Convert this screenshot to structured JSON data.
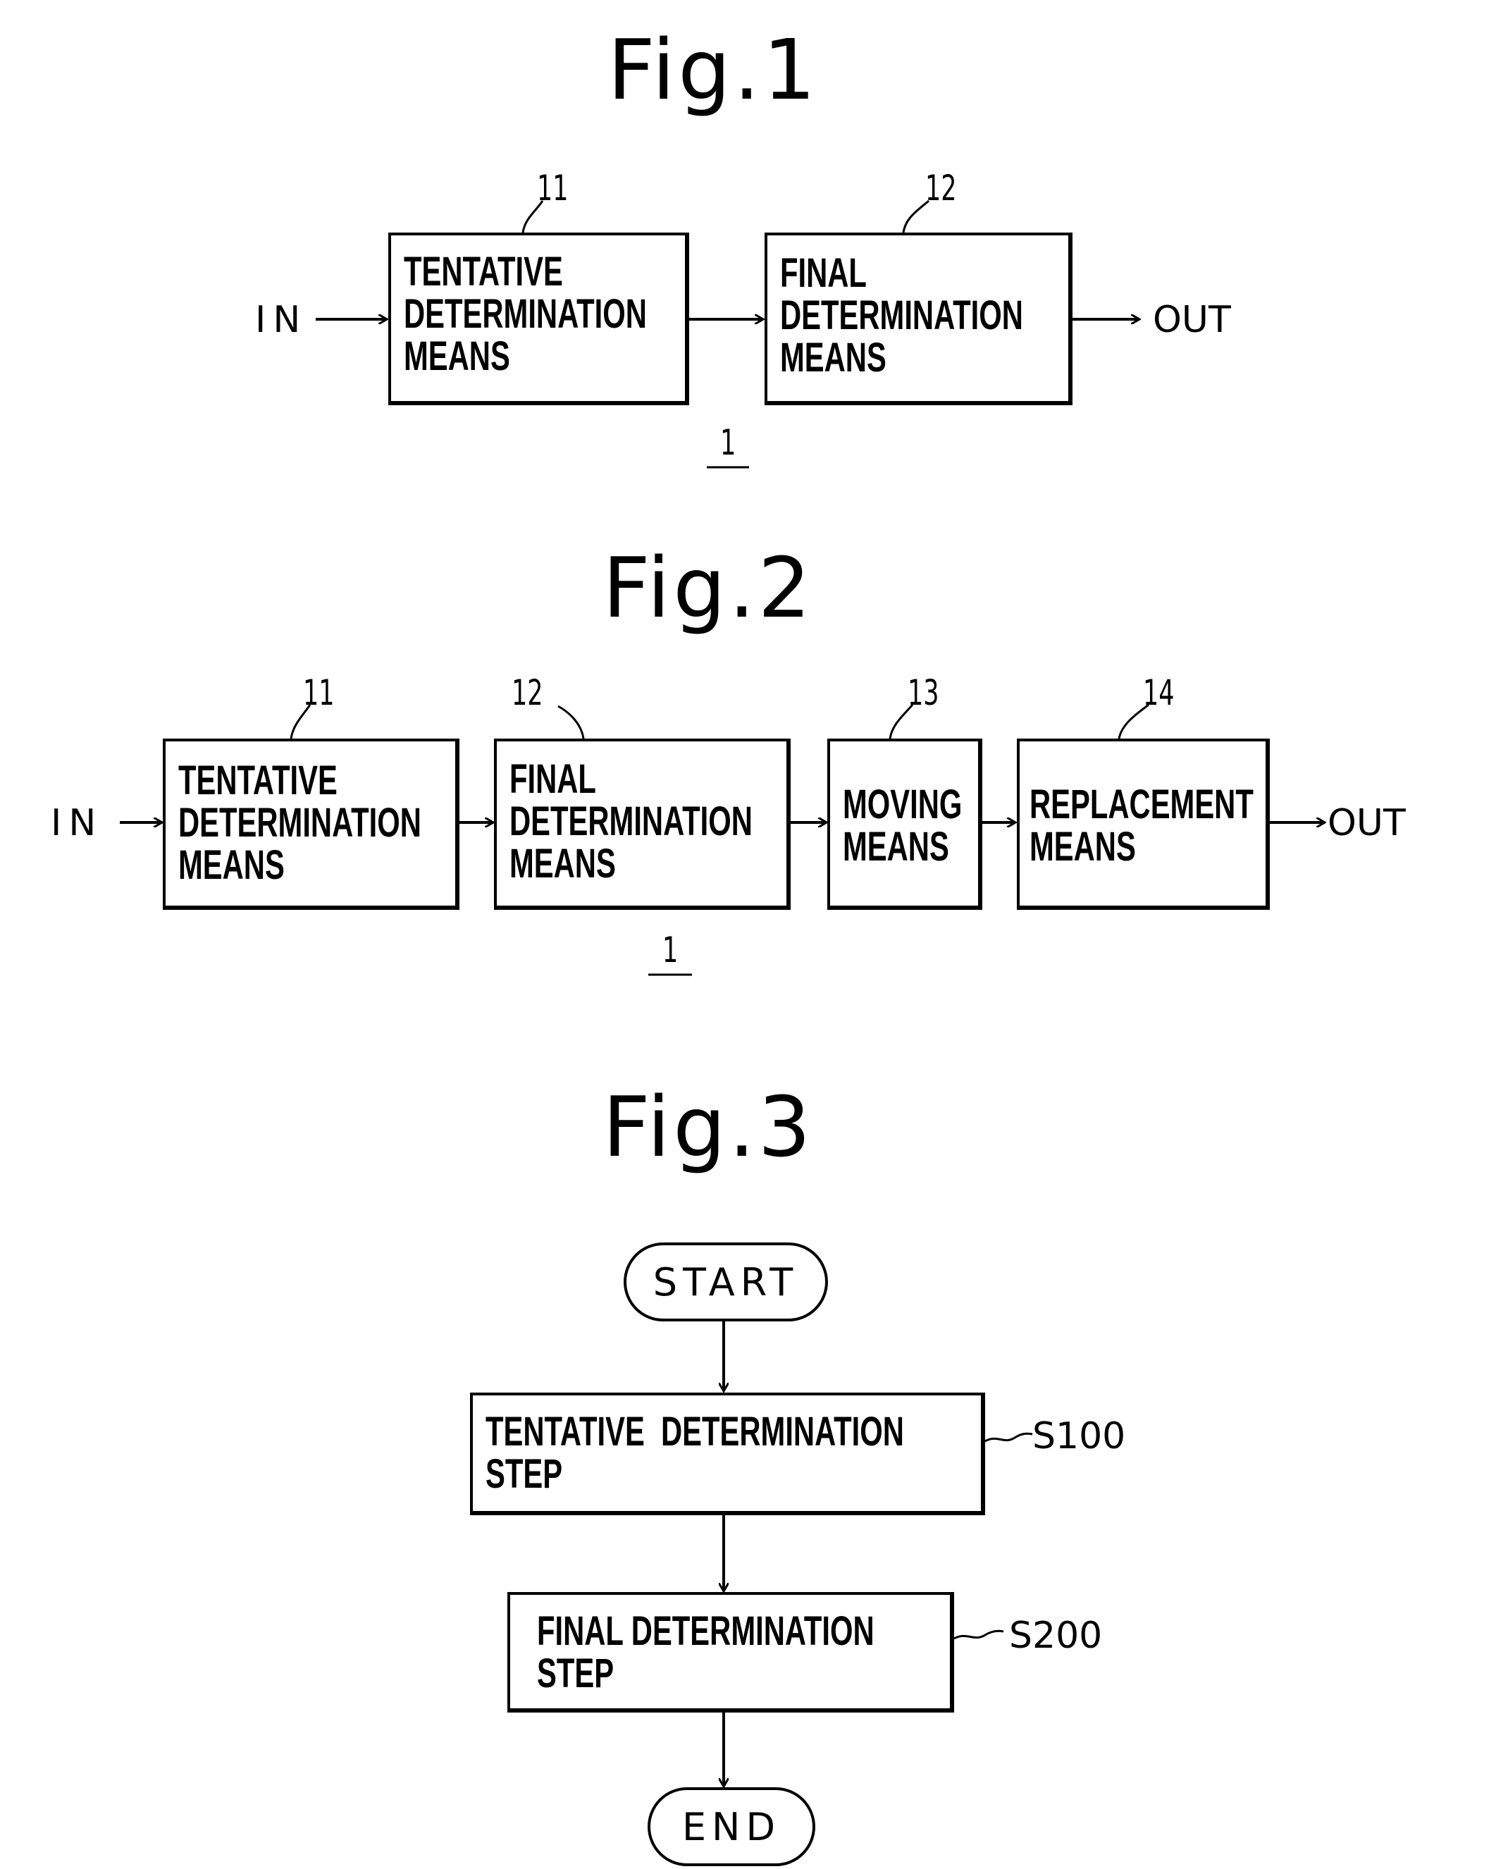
{
  "fig1": {
    "title": "Fig.1",
    "input_label": "IN",
    "output_label": "OUT",
    "system_ref": "1",
    "blocks": [
      {
        "ref": "11",
        "text": "TENTATIVE\nDETERMINATION\nMEANS"
      },
      {
        "ref": "12",
        "text": "FINAL\nDETERMINATION\nMEANS"
      }
    ]
  },
  "fig2": {
    "title": "Fig.2",
    "input_label": "IN",
    "output_label": "OUT",
    "system_ref": "1",
    "blocks": [
      {
        "ref": "11",
        "text": "TENTATIVE\nDETERMINATION\nMEANS"
      },
      {
        "ref": "12",
        "text": "FINAL\nDETERMINATION\nMEANS"
      },
      {
        "ref": "13",
        "text": "MOVING\nMEANS"
      },
      {
        "ref": "14",
        "text": "REPLACEMENT\nMEANS"
      }
    ]
  },
  "fig3": {
    "title": "Fig.3",
    "start_label": "START",
    "end_label": "END",
    "steps": [
      {
        "ref": "S100",
        "text": "TENTATIVE  DETERMINATION\nSTEP"
      },
      {
        "ref": "S200",
        "text": "FINAL DETERMINATION\nSTEP"
      }
    ]
  }
}
